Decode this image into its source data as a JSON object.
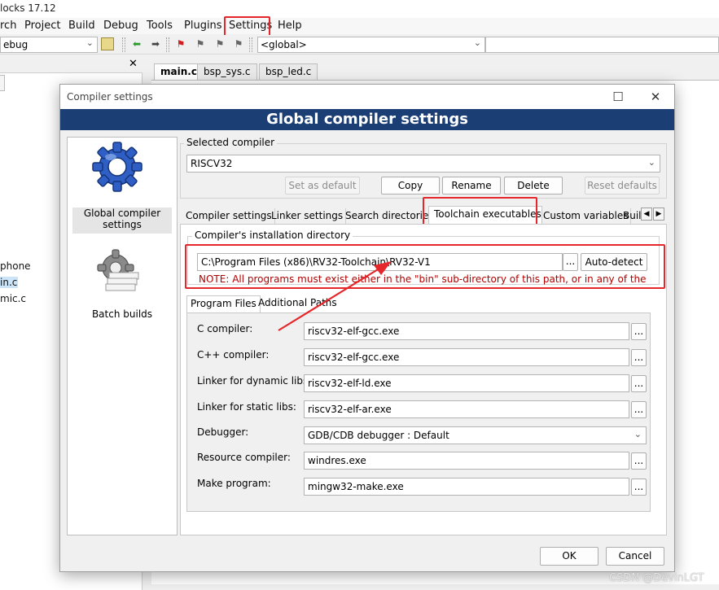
{
  "ide": {
    "title_fragment": "locks 17.12",
    "menu": [
      "rch",
      "Project",
      "Build",
      "Debug",
      "Tools",
      "Plugins",
      "Settings",
      "Help"
    ],
    "build_target": "ebug",
    "global_scope": "<global>",
    "editor_tabs": [
      "main.c",
      "bsp_sys.c",
      "bsp_led.c"
    ],
    "tree_lines": [
      "phone",
      "in.c",
      "mic.c"
    ],
    "close_glyph": "✕"
  },
  "dialog": {
    "window_title": "Compiler settings",
    "banner": "Global compiler settings",
    "categories": [
      "Global compiler settings",
      "Batch builds"
    ],
    "selected_compiler_label": "Selected compiler",
    "selected_compiler": "RISCV32",
    "buttons": {
      "set_default": "Set as default",
      "copy": "Copy",
      "rename": "Rename",
      "delete": "Delete",
      "reset_defaults": "Reset defaults",
      "ok": "OK",
      "cancel": "Cancel",
      "auto_detect": "Auto-detect",
      "ellipsis": "..."
    },
    "tabs": [
      "Compiler settings",
      "Linker settings",
      "Search directories",
      "Toolchain executables",
      "Custom variables",
      "Buil"
    ],
    "active_tab": "Toolchain executables",
    "install_dir_label": "Compiler's installation directory",
    "install_dir": "C:\\Program Files (x86)\\RV32-Toolchain\\RV32-V1",
    "note": "NOTE: All programs must exist either in the \"bin\" sub-directory of this path, or in any of the",
    "subtabs": [
      "Program Files",
      "Additional Paths"
    ],
    "programs": [
      {
        "label": "C compiler:",
        "value": "riscv32-elf-gcc.exe"
      },
      {
        "label": "C++ compiler:",
        "value": "riscv32-elf-gcc.exe"
      },
      {
        "label": "Linker for dynamic libs:",
        "value": "riscv32-elf-ld.exe"
      },
      {
        "label": "Linker for static libs:",
        "value": "riscv32-elf-ar.exe"
      },
      {
        "label": "Debugger:",
        "value": "GDB/CDB debugger : Default"
      },
      {
        "label": "Resource compiler:",
        "value": "windres.exe"
      },
      {
        "label": "Make program:",
        "value": "mingw32-make.exe"
      }
    ]
  },
  "watermark": "CSDN @DevinLGT",
  "colors": {
    "banner": "#1b3e74",
    "highlight": "#e5262b",
    "note": "#b20000"
  }
}
